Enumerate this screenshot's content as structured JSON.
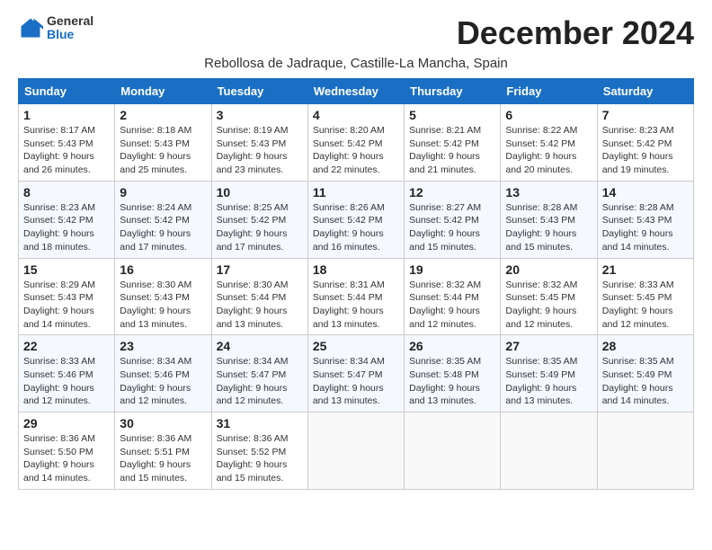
{
  "header": {
    "logo_general": "General",
    "logo_blue": "Blue",
    "month_title": "December 2024",
    "subtitle": "Rebollosa de Jadraque, Castille-La Mancha, Spain"
  },
  "weekdays": [
    "Sunday",
    "Monday",
    "Tuesday",
    "Wednesday",
    "Thursday",
    "Friday",
    "Saturday"
  ],
  "weeks": [
    [
      {
        "day": "1",
        "info": "Sunrise: 8:17 AM\nSunset: 5:43 PM\nDaylight: 9 hours and 26 minutes."
      },
      {
        "day": "2",
        "info": "Sunrise: 8:18 AM\nSunset: 5:43 PM\nDaylight: 9 hours and 25 minutes."
      },
      {
        "day": "3",
        "info": "Sunrise: 8:19 AM\nSunset: 5:43 PM\nDaylight: 9 hours and 23 minutes."
      },
      {
        "day": "4",
        "info": "Sunrise: 8:20 AM\nSunset: 5:42 PM\nDaylight: 9 hours and 22 minutes."
      },
      {
        "day": "5",
        "info": "Sunrise: 8:21 AM\nSunset: 5:42 PM\nDaylight: 9 hours and 21 minutes."
      },
      {
        "day": "6",
        "info": "Sunrise: 8:22 AM\nSunset: 5:42 PM\nDaylight: 9 hours and 20 minutes."
      },
      {
        "day": "7",
        "info": "Sunrise: 8:23 AM\nSunset: 5:42 PM\nDaylight: 9 hours and 19 minutes."
      }
    ],
    [
      {
        "day": "8",
        "info": "Sunrise: 8:23 AM\nSunset: 5:42 PM\nDaylight: 9 hours and 18 minutes."
      },
      {
        "day": "9",
        "info": "Sunrise: 8:24 AM\nSunset: 5:42 PM\nDaylight: 9 hours and 17 minutes."
      },
      {
        "day": "10",
        "info": "Sunrise: 8:25 AM\nSunset: 5:42 PM\nDaylight: 9 hours and 17 minutes."
      },
      {
        "day": "11",
        "info": "Sunrise: 8:26 AM\nSunset: 5:42 PM\nDaylight: 9 hours and 16 minutes."
      },
      {
        "day": "12",
        "info": "Sunrise: 8:27 AM\nSunset: 5:42 PM\nDaylight: 9 hours and 15 minutes."
      },
      {
        "day": "13",
        "info": "Sunrise: 8:28 AM\nSunset: 5:43 PM\nDaylight: 9 hours and 15 minutes."
      },
      {
        "day": "14",
        "info": "Sunrise: 8:28 AM\nSunset: 5:43 PM\nDaylight: 9 hours and 14 minutes."
      }
    ],
    [
      {
        "day": "15",
        "info": "Sunrise: 8:29 AM\nSunset: 5:43 PM\nDaylight: 9 hours and 14 minutes."
      },
      {
        "day": "16",
        "info": "Sunrise: 8:30 AM\nSunset: 5:43 PM\nDaylight: 9 hours and 13 minutes."
      },
      {
        "day": "17",
        "info": "Sunrise: 8:30 AM\nSunset: 5:44 PM\nDaylight: 9 hours and 13 minutes."
      },
      {
        "day": "18",
        "info": "Sunrise: 8:31 AM\nSunset: 5:44 PM\nDaylight: 9 hours and 13 minutes."
      },
      {
        "day": "19",
        "info": "Sunrise: 8:32 AM\nSunset: 5:44 PM\nDaylight: 9 hours and 12 minutes."
      },
      {
        "day": "20",
        "info": "Sunrise: 8:32 AM\nSunset: 5:45 PM\nDaylight: 9 hours and 12 minutes."
      },
      {
        "day": "21",
        "info": "Sunrise: 8:33 AM\nSunset: 5:45 PM\nDaylight: 9 hours and 12 minutes."
      }
    ],
    [
      {
        "day": "22",
        "info": "Sunrise: 8:33 AM\nSunset: 5:46 PM\nDaylight: 9 hours and 12 minutes."
      },
      {
        "day": "23",
        "info": "Sunrise: 8:34 AM\nSunset: 5:46 PM\nDaylight: 9 hours and 12 minutes."
      },
      {
        "day": "24",
        "info": "Sunrise: 8:34 AM\nSunset: 5:47 PM\nDaylight: 9 hours and 12 minutes."
      },
      {
        "day": "25",
        "info": "Sunrise: 8:34 AM\nSunset: 5:47 PM\nDaylight: 9 hours and 13 minutes."
      },
      {
        "day": "26",
        "info": "Sunrise: 8:35 AM\nSunset: 5:48 PM\nDaylight: 9 hours and 13 minutes."
      },
      {
        "day": "27",
        "info": "Sunrise: 8:35 AM\nSunset: 5:49 PM\nDaylight: 9 hours and 13 minutes."
      },
      {
        "day": "28",
        "info": "Sunrise: 8:35 AM\nSunset: 5:49 PM\nDaylight: 9 hours and 14 minutes."
      }
    ],
    [
      {
        "day": "29",
        "info": "Sunrise: 8:36 AM\nSunset: 5:50 PM\nDaylight: 9 hours and 14 minutes."
      },
      {
        "day": "30",
        "info": "Sunrise: 8:36 AM\nSunset: 5:51 PM\nDaylight: 9 hours and 15 minutes."
      },
      {
        "day": "31",
        "info": "Sunrise: 8:36 AM\nSunset: 5:52 PM\nDaylight: 9 hours and 15 minutes."
      },
      null,
      null,
      null,
      null
    ]
  ]
}
